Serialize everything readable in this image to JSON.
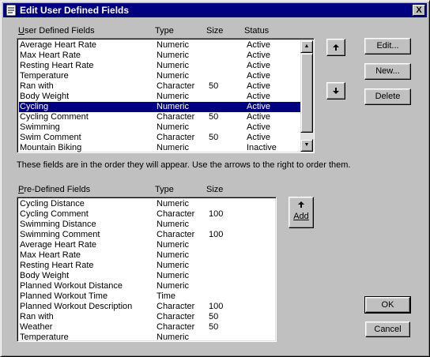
{
  "window": {
    "title": "Edit User Defined Fields",
    "close_label": "X"
  },
  "user_defined": {
    "headers": {
      "name": "User Defined Fields",
      "type": "Type",
      "size": "Size",
      "status": "Status"
    },
    "rows": [
      {
        "name": "Average Heart Rate",
        "type": "Numeric",
        "size": "",
        "status": "Active"
      },
      {
        "name": "Max Heart Rate",
        "type": "Numeric",
        "size": "",
        "status": "Active"
      },
      {
        "name": "Resting Heart Rate",
        "type": "Numeric",
        "size": "",
        "status": "Active"
      },
      {
        "name": "Temperature",
        "type": "Numeric",
        "size": "",
        "status": "Active"
      },
      {
        "name": "Ran with",
        "type": "Character",
        "size": "50",
        "status": "Active"
      },
      {
        "name": "Body Weight",
        "type": "Numeric",
        "size": "",
        "status": "Active"
      },
      {
        "name": "Cycling",
        "type": "Numeric",
        "size": "",
        "status": "Active",
        "selected": true
      },
      {
        "name": "Cycling Comment",
        "type": "Character",
        "size": "50",
        "status": "Active"
      },
      {
        "name": "Swimming",
        "type": "Numeric",
        "size": "",
        "status": "Active"
      },
      {
        "name": "Swim Comment",
        "type": "Character",
        "size": "50",
        "status": "Active"
      },
      {
        "name": "Mountain Biking",
        "type": "Numeric",
        "size": "",
        "status": "Inactive"
      }
    ],
    "hint": "These fields are in the order they will appear.  Use the arrows to the right to order them."
  },
  "predefined": {
    "headers": {
      "name": "Pre-Defined Fields",
      "type": "Type",
      "size": "Size"
    },
    "rows": [
      {
        "name": "Cycling Distance",
        "type": "Numeric",
        "size": ""
      },
      {
        "name": "Cycling Comment",
        "type": "Character",
        "size": "100"
      },
      {
        "name": "Swimming Distance",
        "type": "Numeric",
        "size": ""
      },
      {
        "name": "Swimming Comment",
        "type": "Character",
        "size": "100"
      },
      {
        "name": "Average Heart Rate",
        "type": "Numeric",
        "size": ""
      },
      {
        "name": "Max Heart Rate",
        "type": "Numeric",
        "size": ""
      },
      {
        "name": "Resting Heart Rate",
        "type": "Numeric",
        "size": ""
      },
      {
        "name": "Body Weight",
        "type": "Numeric",
        "size": ""
      },
      {
        "name": "Planned Workout Distance",
        "type": "Numeric",
        "size": ""
      },
      {
        "name": "Planned Workout Time",
        "type": "Time",
        "size": ""
      },
      {
        "name": "Planned Workout Description",
        "type": "Character",
        "size": "100"
      },
      {
        "name": "Ran with",
        "type": "Character",
        "size": "50"
      },
      {
        "name": "Weather",
        "type": "Character",
        "size": "50"
      },
      {
        "name": "Temperature",
        "type": "Numeric",
        "size": ""
      }
    ]
  },
  "buttons": {
    "edit": "Edit...",
    "new": "New...",
    "delete": "Delete",
    "add": "Add",
    "ok": "OK",
    "cancel": "Cancel",
    "move_up_icon": "up-arrow-icon",
    "move_down_icon": "down-arrow-icon"
  },
  "colors": {
    "titlebar": "#000080",
    "selection": "#000080",
    "face": "#c0c0c0"
  }
}
